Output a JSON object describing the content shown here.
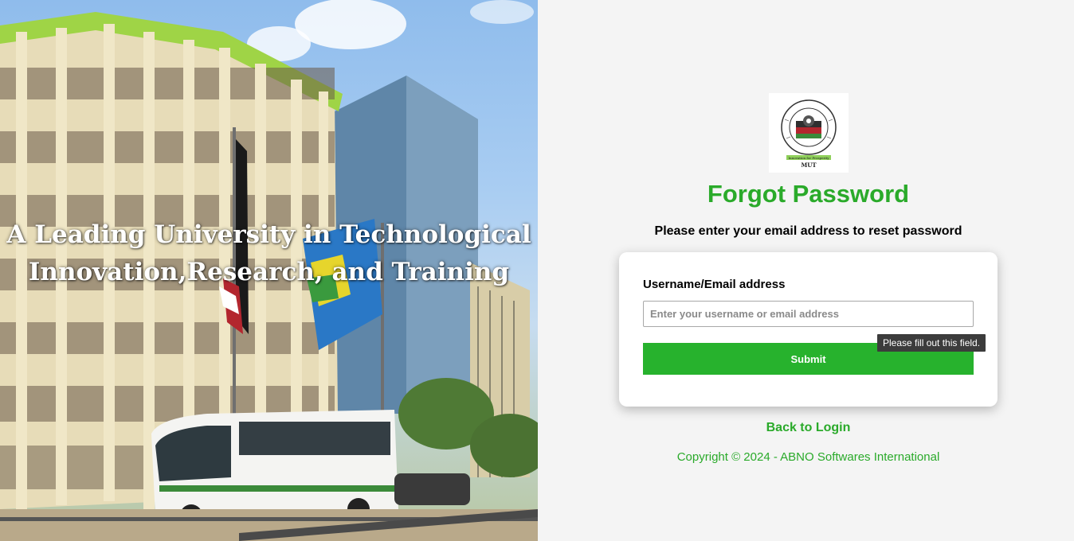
{
  "hero": {
    "tagline_line1": "A Leading University in Technological",
    "tagline_line2": "Innovation,Research, and Training"
  },
  "logo": {
    "ring_text": "MURANG'A UNIVERSITY OF TECHNOLOGY",
    "motto": "Innovation for Prosperity",
    "abbrev": "MUT"
  },
  "form": {
    "title": "Forgot Password",
    "subtitle": "Please enter your email address to reset password",
    "field_label": "Username/Email address",
    "field_value": "",
    "field_placeholder": "Enter your username or email address",
    "submit_label": "Submit",
    "validation_tooltip": "Please fill out this field."
  },
  "footer": {
    "back_link": "Back to Login",
    "copyright": "Copyright © 2024 - ABNO Softwares International"
  },
  "colors": {
    "accent": "#2aaa2a",
    "button": "#27b22d",
    "panel_bg": "#f4f4f4",
    "tooltip_bg": "#3c3c3c"
  },
  "icons": [
    "university-logo"
  ]
}
